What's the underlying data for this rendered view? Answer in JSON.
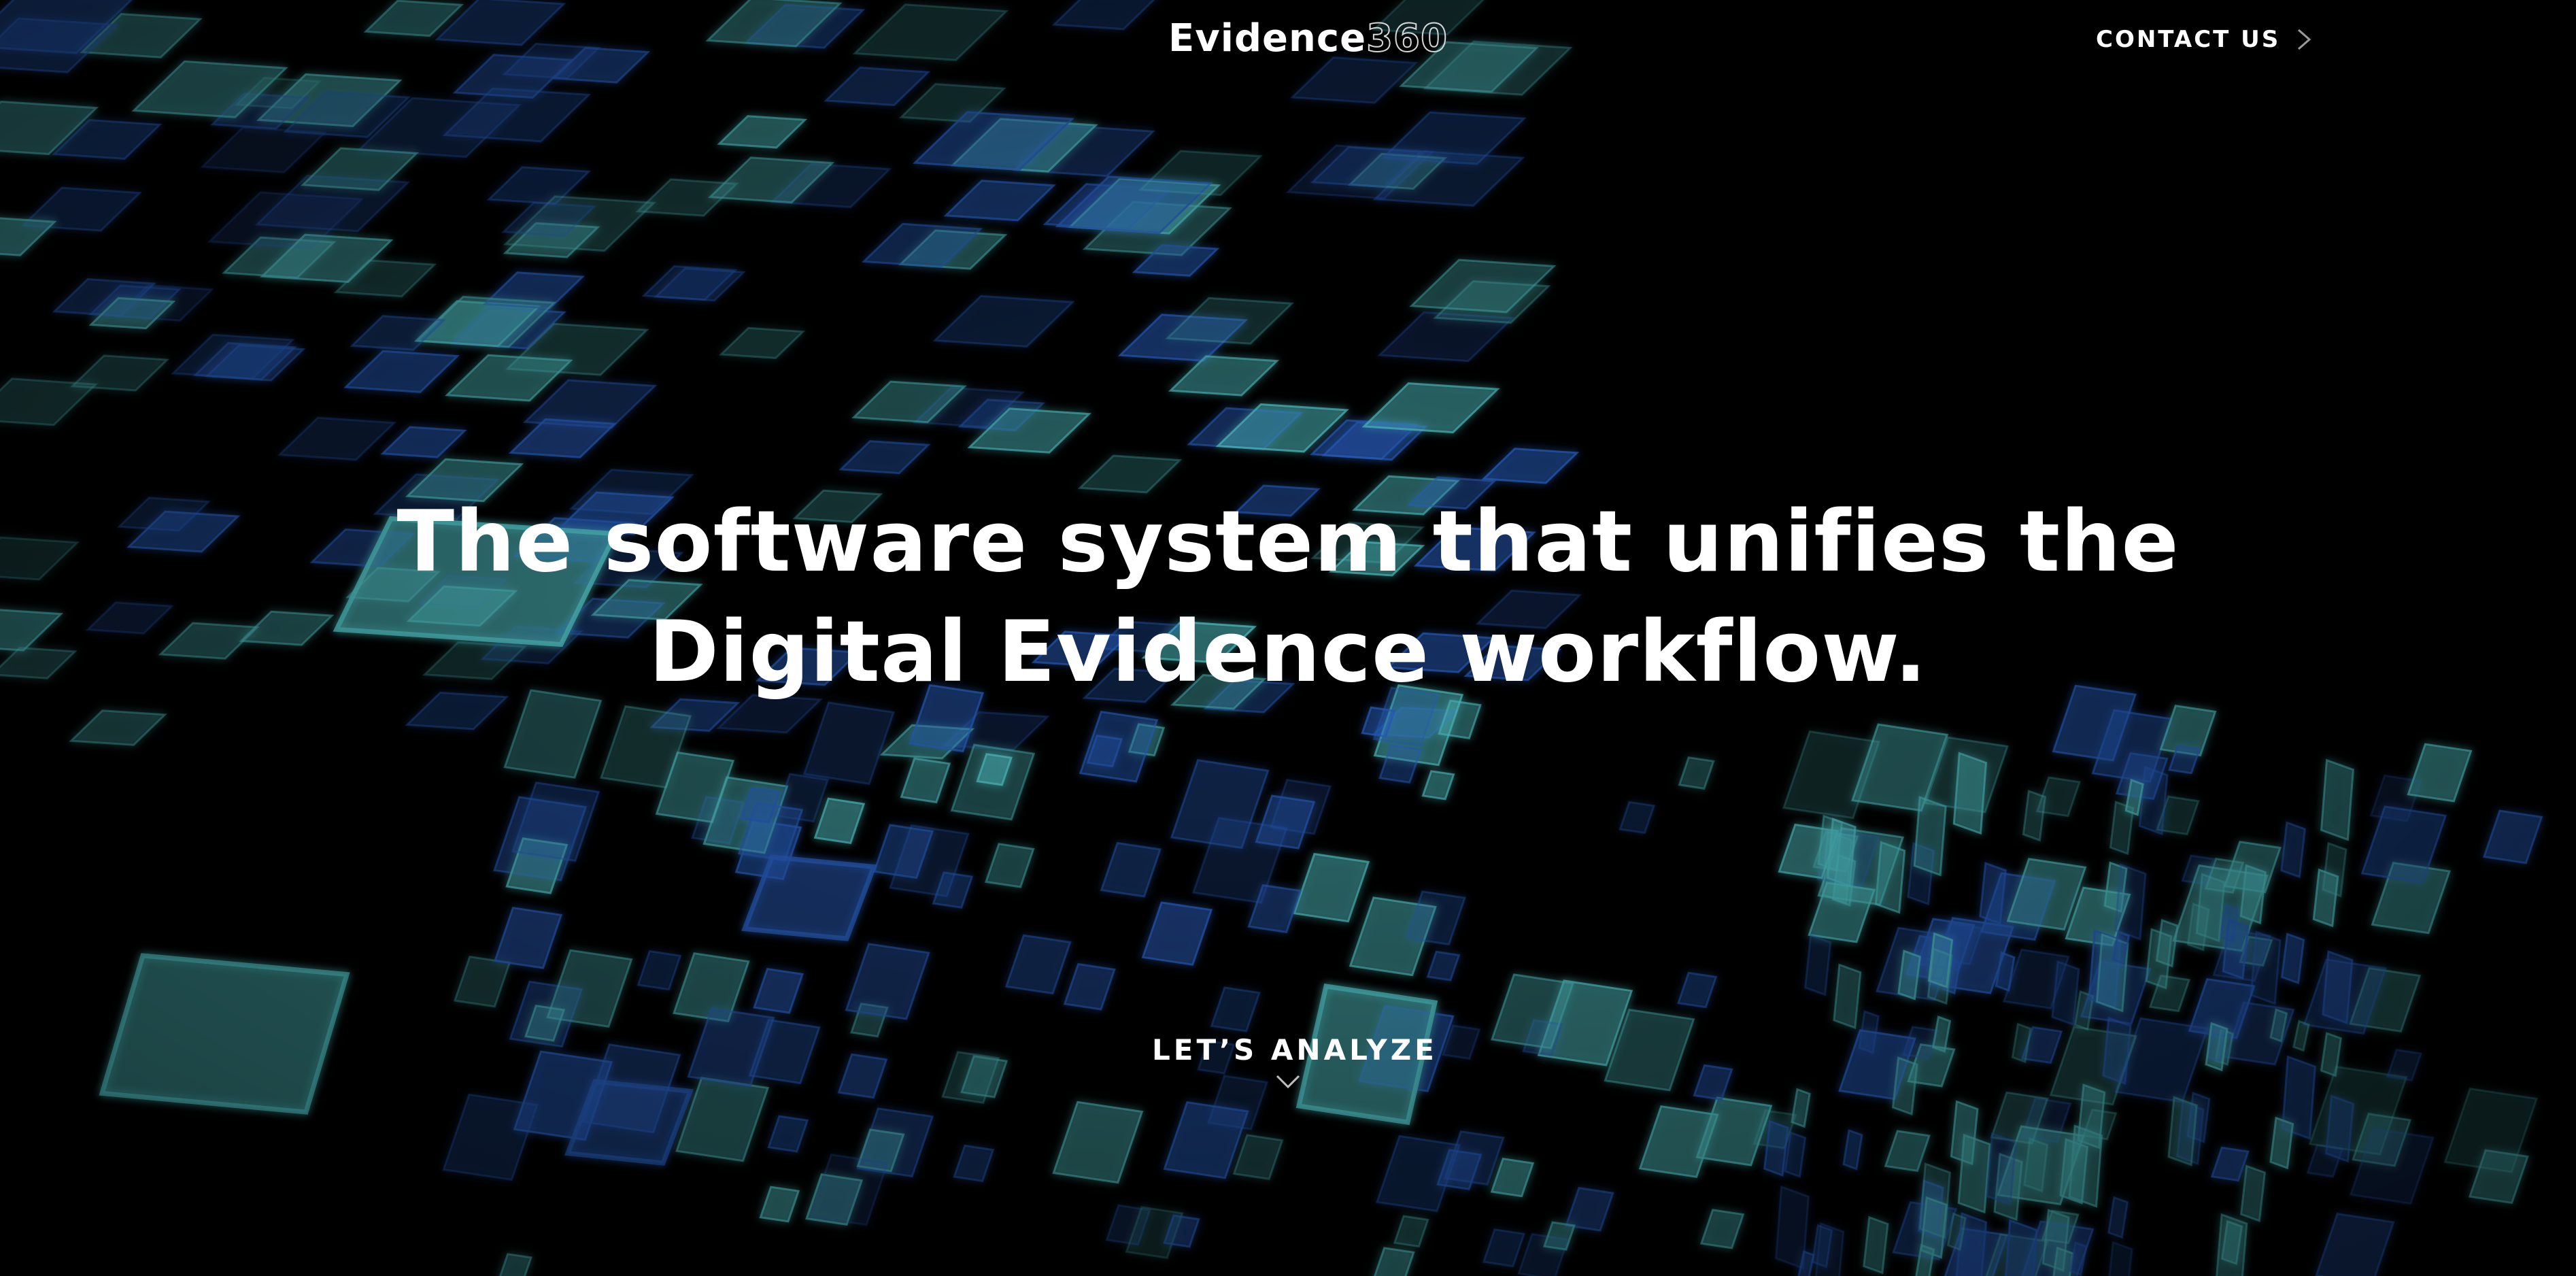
{
  "header": {
    "logo_text": "Evidence",
    "logo_number": "360",
    "contact_label": "CONTACT US",
    "contact_icon": "chevron-right-icon"
  },
  "hero": {
    "headline_line1": "The software system that unifies the",
    "headline_line2": "Digital Evidence workflow.",
    "cta_label": "LET’S ANALYZE",
    "cta_icon": "chevron-down-icon",
    "background": "perspective grid of glowing blue and cyan tiles on black"
  },
  "colors": {
    "background": "#000000",
    "text": "#ffffff",
    "tile_blue": "#2f6fe0",
    "tile_cyan": "#5ee3e6"
  }
}
